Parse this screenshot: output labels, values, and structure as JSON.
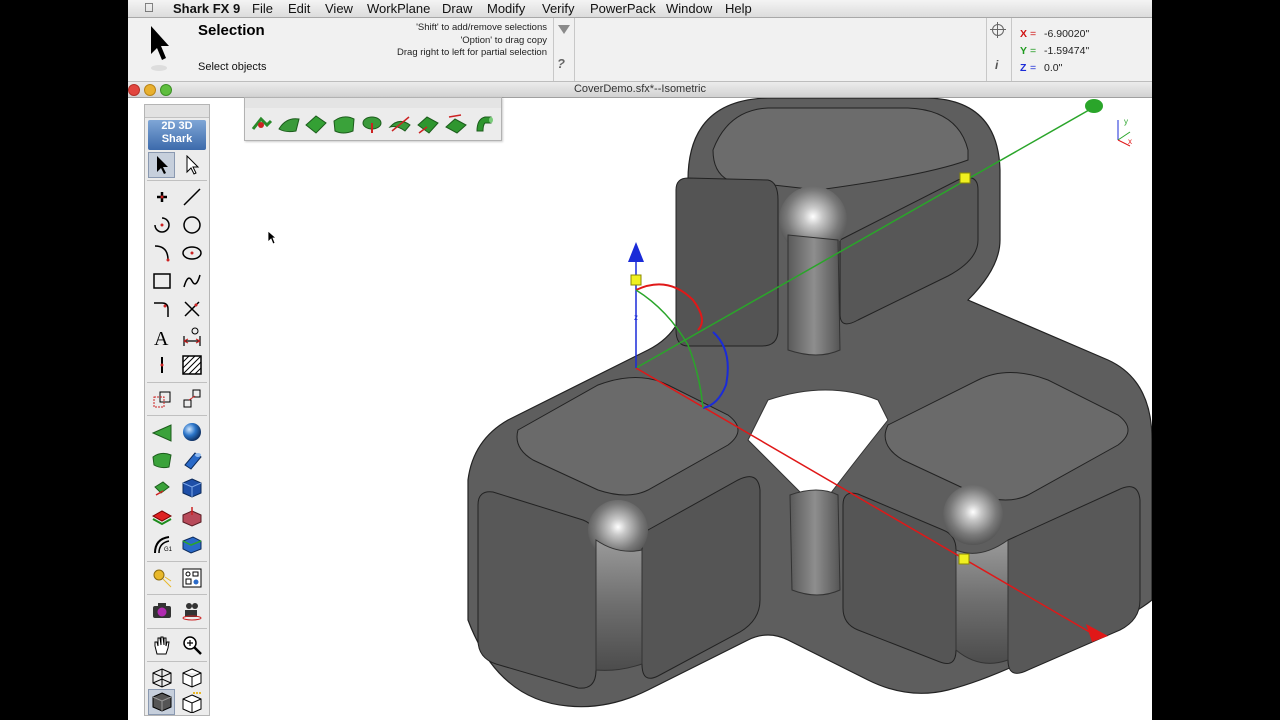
{
  "menubar": {
    "app_name": "Shark FX 9",
    "items": [
      "File",
      "Edit",
      "View",
      "WorkPlane",
      "Draw",
      "Modify",
      "Verify",
      "PowerPack",
      "Window",
      "Help"
    ]
  },
  "tool_panel": {
    "title": "Selection",
    "subtitle": "Select objects",
    "hints": [
      "'Shift' to add/remove selections",
      "'Option' to drag copy",
      "Drag right to left for partial selection"
    ],
    "help_mark": "?",
    "info_mark": "i"
  },
  "coords": {
    "x_label": "X",
    "x_value": "-6.90020\"",
    "y_label": "Y",
    "y_value": "-1.59474\"",
    "z_label": "Z",
    "z_value": "0.0\"",
    "eq": "="
  },
  "window": {
    "title": "CoverDemo.sfx*--Isometric"
  },
  "left_toolbar": {
    "logo_top": "2D 3D",
    "logo_bottom": "Shark",
    "tools": [
      "select-arrow",
      "select-subobject",
      "point",
      "line",
      "arc-3pt",
      "circle",
      "arc-tangent",
      "ellipse",
      "rectangle",
      "spline",
      "fillet",
      "trim",
      "text",
      "dimension",
      "vertical-line",
      "hatch",
      "transform",
      "array",
      "extrude-surface",
      "sphere",
      "loft-surface",
      "cylinder",
      "revolve",
      "box",
      "sweep",
      "boolean",
      "deform",
      "solid-split",
      "render-lights",
      "layers",
      "camera",
      "animation",
      "pan-hand",
      "zoom",
      "view-iso",
      "view-cube",
      "view-shaded",
      "view-render"
    ]
  },
  "float_toolbar": {
    "tools": [
      "surface-point",
      "surface-ruled",
      "surface-loft",
      "surface-patch",
      "surface-revolve",
      "surface-sweep",
      "surface-blend",
      "surface-offset",
      "surface-pipe"
    ]
  },
  "viewport": {
    "axes_labels": {
      "z": "z",
      "gizmo_y": "y",
      "gizmo_x": "x"
    },
    "colors": {
      "x_axis": "#e01818",
      "y_axis": "#2aa52a",
      "z_axis": "#1a2bd8",
      "body": "#6a6a6a",
      "handle": "#f0f020"
    }
  }
}
